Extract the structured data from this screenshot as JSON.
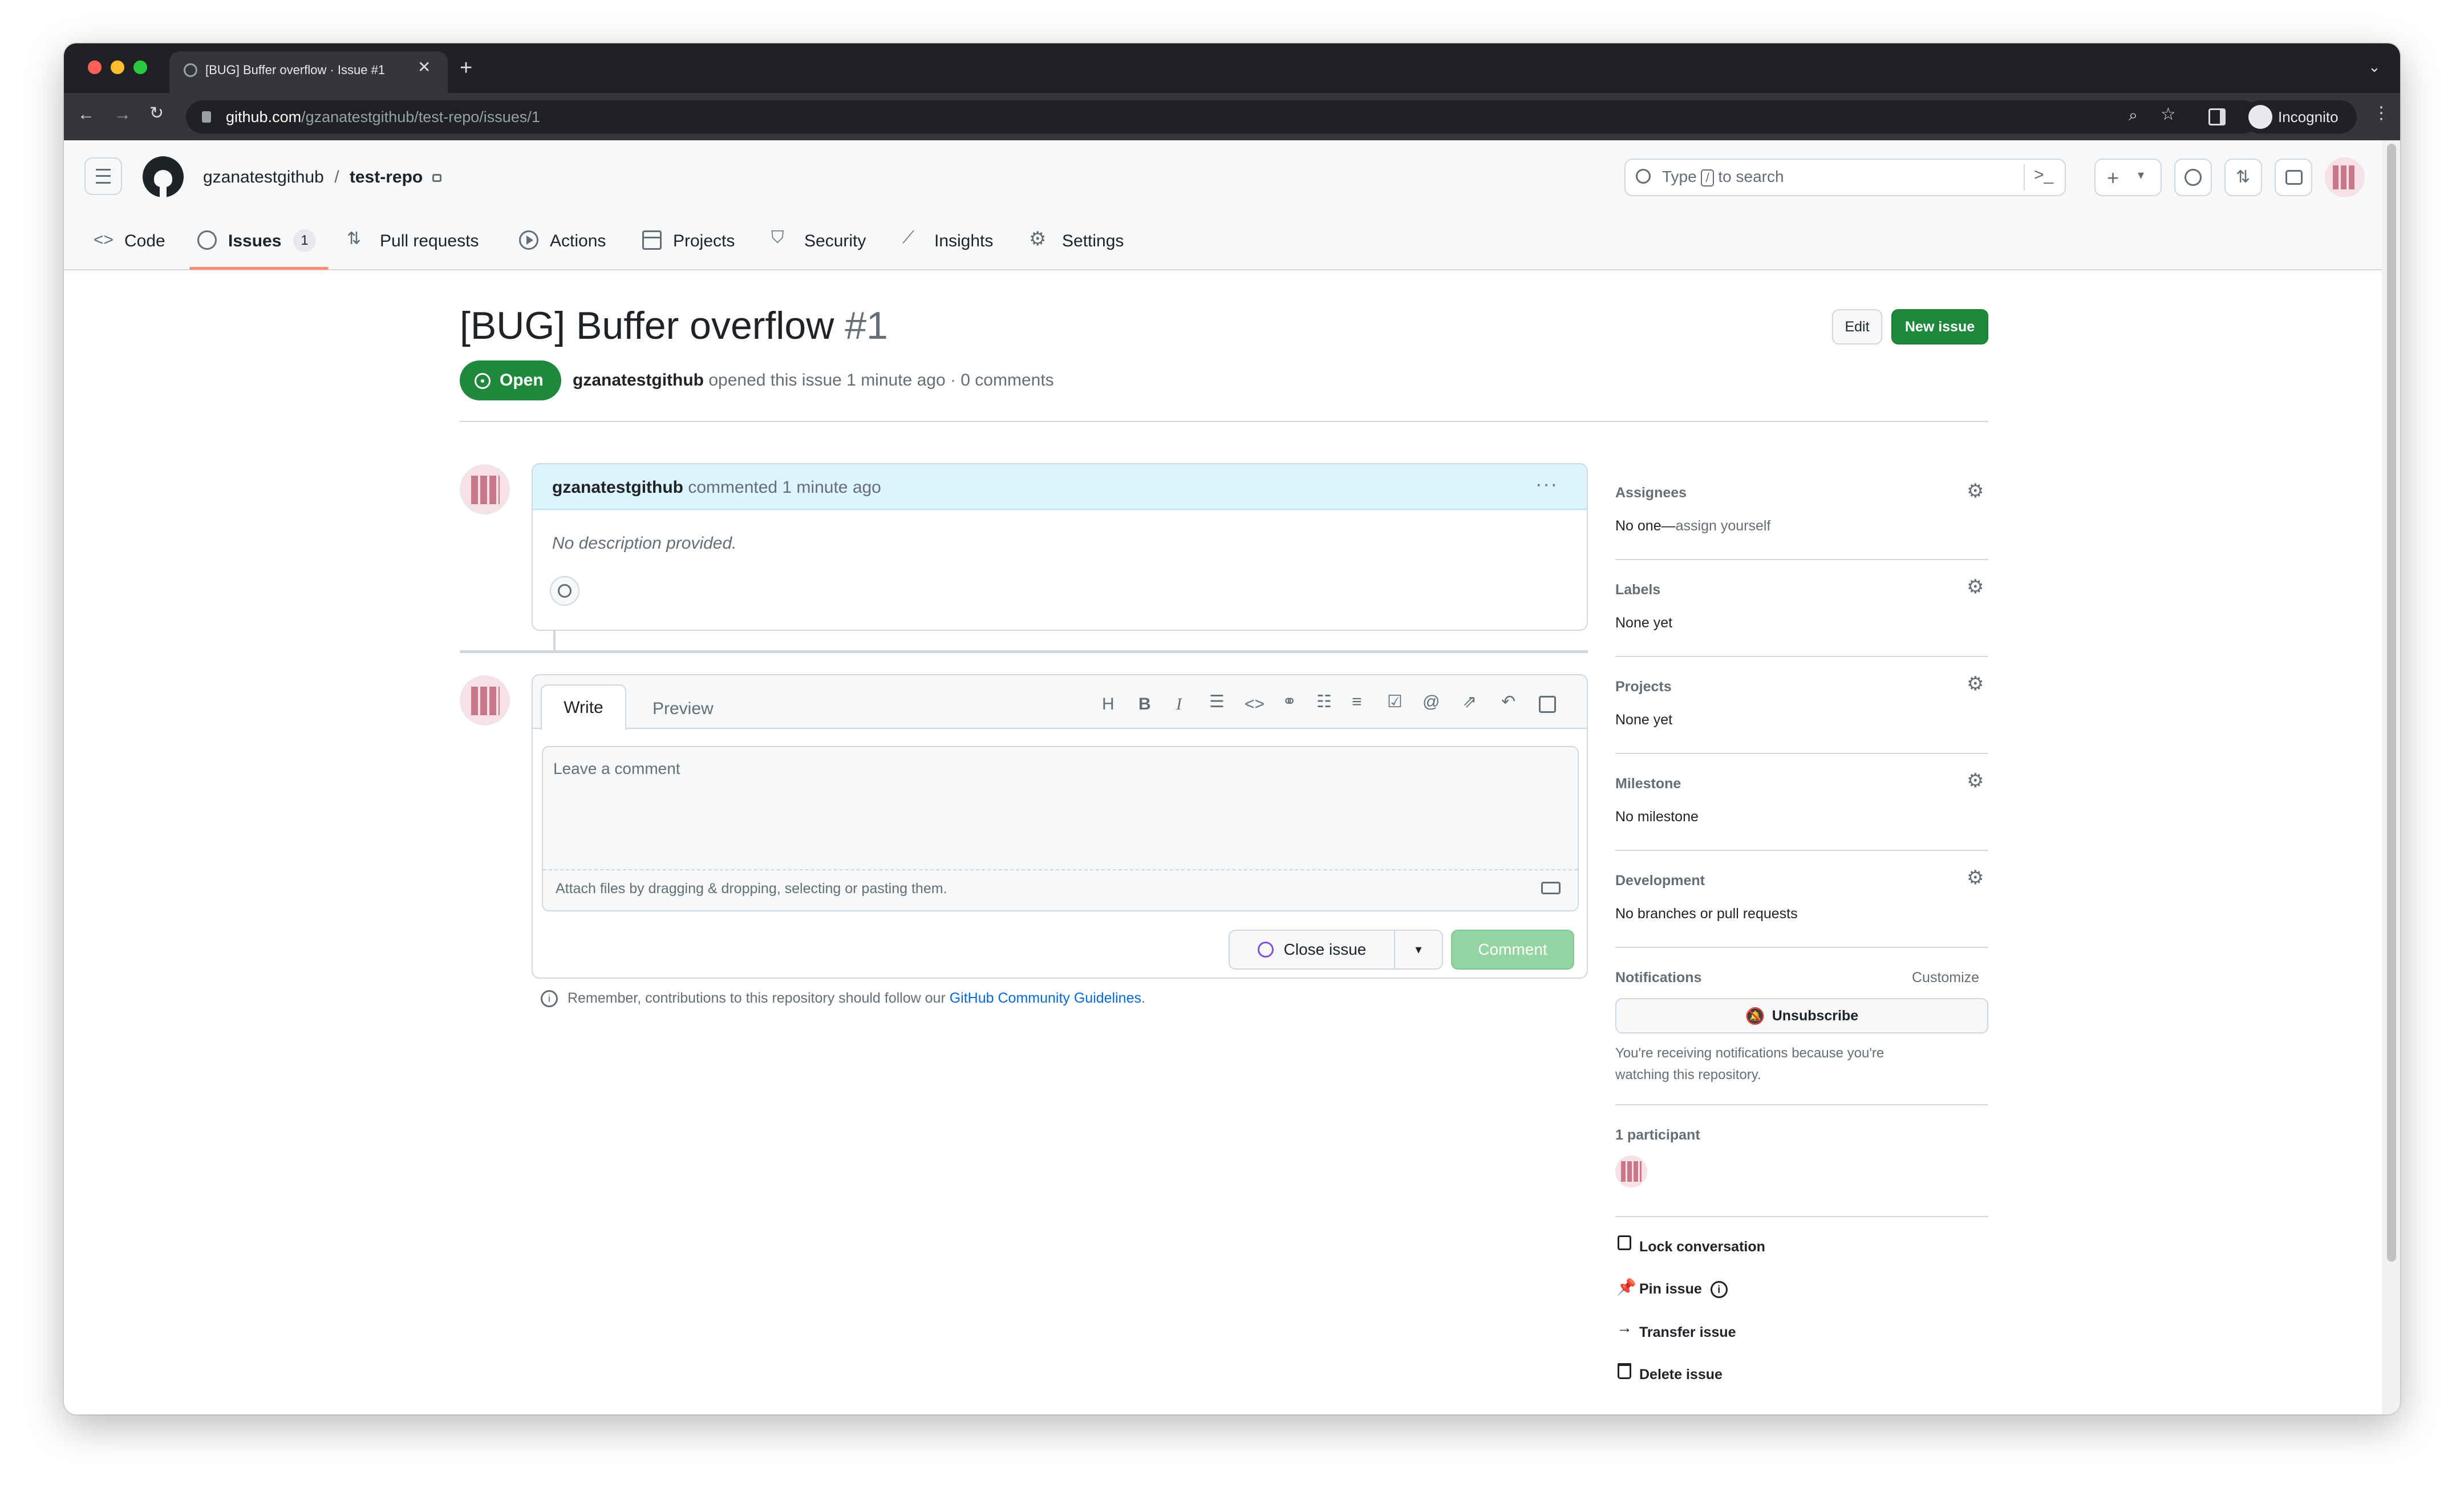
{
  "browser": {
    "tab_title": "[BUG] Buffer overflow · Issue #1",
    "url_host": "github.com",
    "url_path": "/gzanatestgithub/test-repo/issues/1",
    "profile_label": "Incognito"
  },
  "repo": {
    "owner": "gzanatestgithub",
    "separator": "/",
    "name": "test-repo",
    "search_placeholder_pre": "Type",
    "search_key": "/",
    "search_placeholder_post": "to search"
  },
  "nav": {
    "code": "Code",
    "issues": "Issues",
    "issues_count": "1",
    "pull_requests": "Pull requests",
    "actions": "Actions",
    "projects": "Projects",
    "security": "Security",
    "insights": "Insights",
    "settings": "Settings"
  },
  "issue": {
    "title": "[BUG] Buffer overflow",
    "number": "#1",
    "state": "Open",
    "author": "gzanatestgithub",
    "opened_text": "opened this issue 1 minute ago · 0 comments",
    "edit_label": "Edit",
    "new_issue_label": "New issue"
  },
  "comment": {
    "author": "gzanatestgithub",
    "time": "commented 1 minute ago",
    "body": "No description provided."
  },
  "composer": {
    "tab_write": "Write",
    "tab_preview": "Preview",
    "placeholder": "Leave a comment",
    "attach_hint": "Attach files by dragging & dropping, selecting or pasting them.",
    "close_label": "Close issue",
    "comment_label": "Comment",
    "guideline_pre": "Remember, contributions to this repository should follow our",
    "guideline_link": "GitHub Community Guidelines",
    "guideline_post": "."
  },
  "sidebar": {
    "assignees_h": "Assignees",
    "assignees_v1": "No one—",
    "assignees_v2": "assign yourself",
    "labels_h": "Labels",
    "labels_v": "None yet",
    "projects_h": "Projects",
    "projects_v": "None yet",
    "milestone_h": "Milestone",
    "milestone_v": "No milestone",
    "development_h": "Development",
    "development_v": "No branches or pull requests",
    "notifications_h": "Notifications",
    "customize": "Customize",
    "unsubscribe": "Unsubscribe",
    "notif_note_1": "You're receiving notifications because you're",
    "notif_note_2": "watching this repository.",
    "participants": "1 participant",
    "lock": "Lock conversation",
    "pin": "Pin issue",
    "transfer": "Transfer issue",
    "delete": "Delete issue"
  },
  "colors": {
    "open_green": "#1f883d",
    "link_blue": "#0969da",
    "comment_header_bg": "#ddf4ff",
    "active_tab_underline": "#fd8c73"
  }
}
